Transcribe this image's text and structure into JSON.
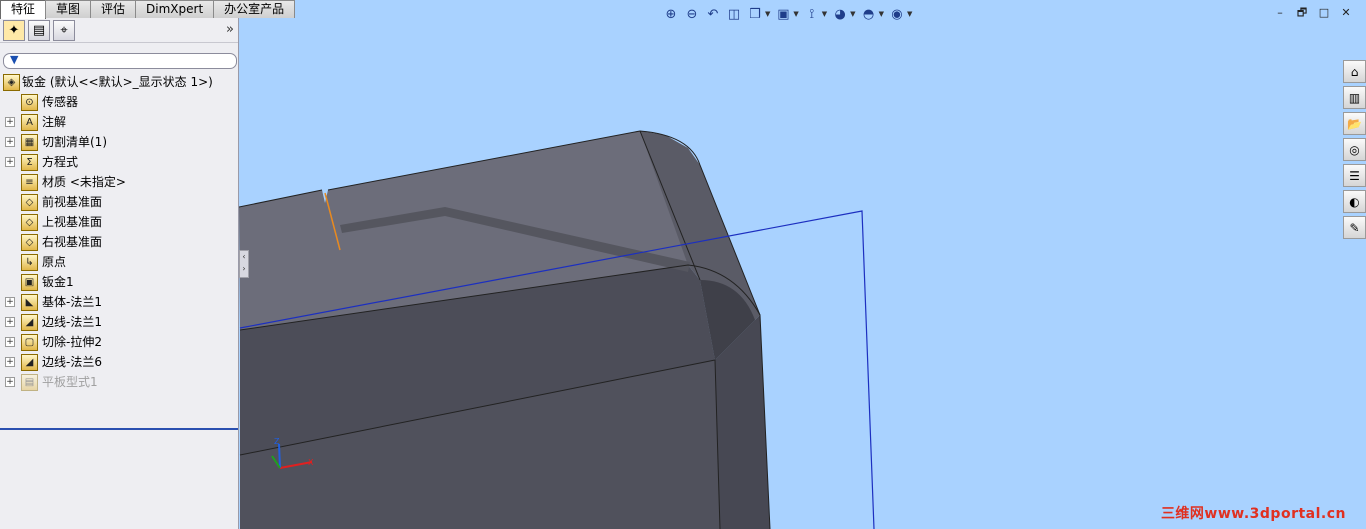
{
  "tabs": [
    "特征",
    "草图",
    "评估",
    "DimXpert",
    "办公室产品"
  ],
  "active_tab": 0,
  "panel": {
    "tab_icons": [
      "feature-manager-icon",
      "property-manager-icon",
      "configuration-manager-icon"
    ],
    "collapse_glyph": "»",
    "filter_icon": "filter-icon"
  },
  "tree": {
    "root": "钣金 (默认<<默认>_显示状态 1>)",
    "items": [
      {
        "label": "传感器",
        "icon": "sensor-icon",
        "expand": false,
        "glyph": "⊙"
      },
      {
        "label": "注解",
        "icon": "annotation-icon",
        "expand": true,
        "glyph": "A"
      },
      {
        "label": "切割清单(1)",
        "icon": "cut-list-icon",
        "expand": true,
        "glyph": "▦"
      },
      {
        "label": "方程式",
        "icon": "equation-icon",
        "expand": true,
        "glyph": "Σ"
      },
      {
        "label": "材质 <未指定>",
        "icon": "material-icon",
        "expand": false,
        "glyph": "≡"
      },
      {
        "label": "前视基准面",
        "icon": "plane-icon",
        "expand": false,
        "glyph": "◇"
      },
      {
        "label": "上视基准面",
        "icon": "plane-icon",
        "expand": false,
        "glyph": "◇"
      },
      {
        "label": "右视基准面",
        "icon": "plane-icon",
        "expand": false,
        "glyph": "◇"
      },
      {
        "label": "原点",
        "icon": "origin-icon",
        "expand": false,
        "glyph": "↳"
      },
      {
        "label": "钣金1",
        "icon": "sheet-metal-icon",
        "expand": false,
        "glyph": "▣"
      },
      {
        "label": "基体-法兰1",
        "icon": "base-flange-icon",
        "expand": true,
        "glyph": "◣"
      },
      {
        "label": "边线-法兰1",
        "icon": "edge-flange-icon",
        "expand": true,
        "glyph": "◢"
      },
      {
        "label": "切除-拉伸2",
        "icon": "cut-extrude-icon",
        "expand": true,
        "glyph": "▢"
      },
      {
        "label": "边线-法兰6",
        "icon": "edge-flange-icon",
        "expand": true,
        "glyph": "◢"
      },
      {
        "label": "平板型式1",
        "icon": "flat-pattern-icon",
        "expand": true,
        "glyph": "▤",
        "suppressed": true
      }
    ]
  },
  "hud_icons": [
    "zoom-to-fit-icon",
    "zoom-to-area-icon",
    "previous-view-icon",
    "section-view-icon",
    "view-orientation-icon",
    "display-style-icon",
    "hide-show-items-icon",
    "edit-appearance-icon",
    "apply-scene-icon",
    "view-settings-icon"
  ],
  "hud_glyphs": [
    "⊕",
    "⊖",
    "↶",
    "◫",
    "❒",
    "▣",
    "⟟",
    "◕",
    "◓",
    "◉"
  ],
  "window_buttons": [
    "–",
    "🗗",
    "□",
    "✕"
  ],
  "taskpane_icons": [
    "solidworks-resources-icon",
    "design-library-icon",
    "file-explorer-icon",
    "search-icon",
    "view-palette-icon",
    "appearances-icon",
    "custom-properties-icon"
  ],
  "taskpane_glyphs": [
    "⌂",
    "▥",
    "📂",
    "◎",
    "☰",
    "◐",
    "✎"
  ],
  "triad": {
    "x": "X",
    "y": "Y",
    "z": "Z"
  },
  "watermark": "三维网www.3dportal.cn",
  "colors": {
    "viewport_bg": "#a9d2ff",
    "part_face": "#5e5f6c",
    "edge": "#2a2a2a",
    "plane": "#1c2fc0"
  }
}
